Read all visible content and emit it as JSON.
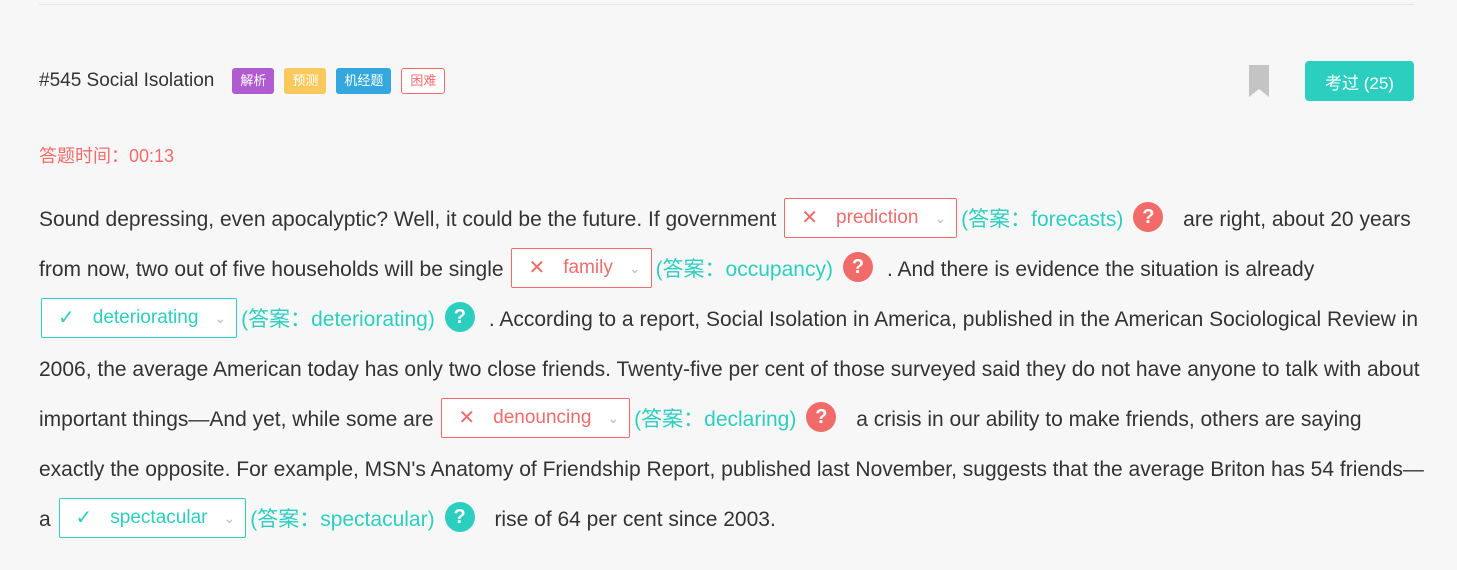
{
  "question": {
    "title": "#545 Social Isolation",
    "tags": [
      "解析",
      "预测",
      "机经题",
      "困难"
    ],
    "exam_button": "考过 (25)"
  },
  "timer": {
    "text": "答题时间：00:13"
  },
  "passage": {
    "t0": "Sound depressing, even apocalyptic? Well, it could be the future. If government",
    "b1": {
      "value": "prediction",
      "answer": "(答案：forecasts)",
      "status": "wrong"
    },
    "t1": "are right, about 20 years from now, two out of five households will be single",
    "b2": {
      "value": "family",
      "answer": "(答案：occupancy)",
      "status": "wrong"
    },
    "t2": ". And there is evidence the situation is already",
    "b3": {
      "value": "deteriorating",
      "answer": "(答案：deteriorating)",
      "status": "correct"
    },
    "t3": ". According to a report, Social Isolation in America, published in the American Sociological Review in 2006, the average American today has only two close friends. Twenty-five per cent of those surveyed said they do not have anyone to talk with about important things—And yet, while some are",
    "b4": {
      "value": "denouncing",
      "answer": "(答案：declaring)",
      "status": "wrong"
    },
    "t4": "a crisis in our ability to make friends, others are saying exactly the opposite. For example, MSN's Anatomy of Friendship Report, published last November, suggests that the average Briton has 54 friends—a",
    "b5": {
      "value": "spectacular",
      "answer": "(答案：spectacular)",
      "status": "correct"
    },
    "t5": "rise of 64 per cent since 2003."
  },
  "icons": {
    "wrong_mark": "✕",
    "correct_mark": "✓",
    "chevron": "chevron-down-icon",
    "help": "?"
  },
  "colors": {
    "accent": "#2ccfbf",
    "error": "#f26b6b",
    "tag_purple": "#b15bd0",
    "tag_yellow": "#fbc95b",
    "tag_blue": "#33a7de"
  }
}
